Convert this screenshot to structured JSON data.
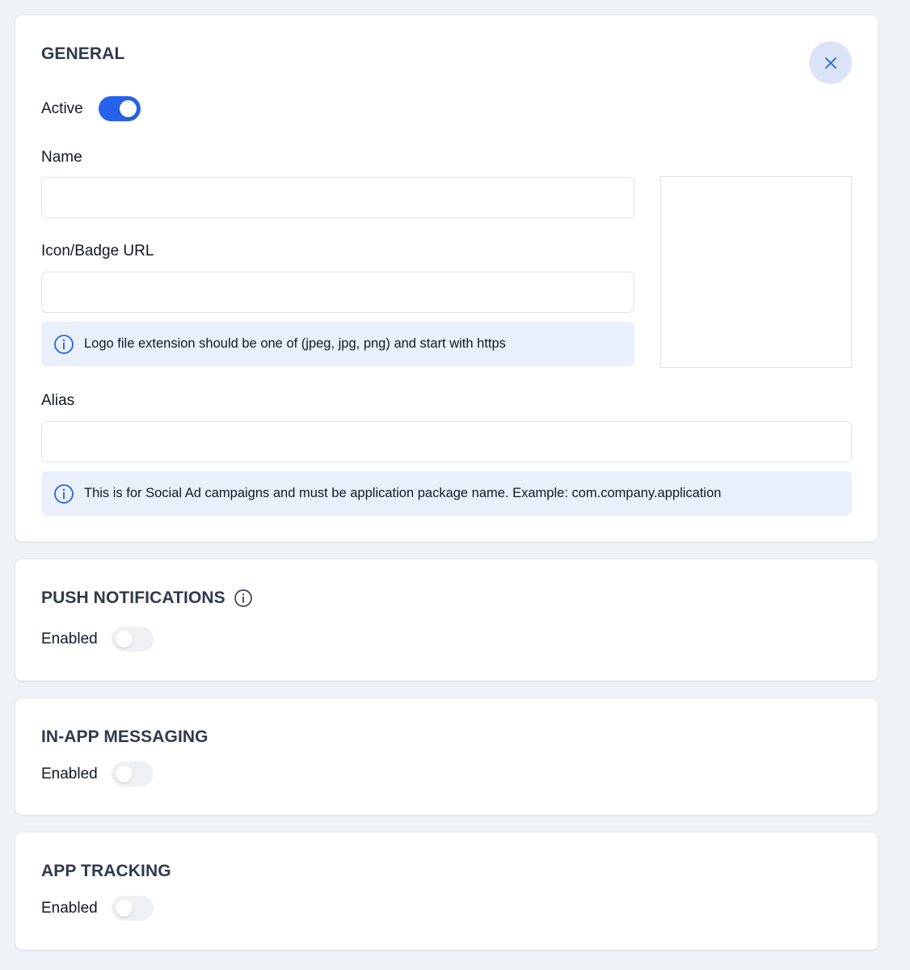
{
  "general": {
    "title": "GENERAL",
    "active_label": "Active",
    "active_on": true,
    "name_label": "Name",
    "name_value": "",
    "icon_url_label": "Icon/Badge URL",
    "icon_url_value": "",
    "icon_note": "Logo file extension should be one of (jpeg, jpg, png) and start with https",
    "alias_label": "Alias",
    "alias_value": "",
    "alias_note": "This is for Social Ad campaigns and must be application package name. Example: com.company.application"
  },
  "push": {
    "title": "PUSH NOTIFICATIONS",
    "enabled_label": "Enabled",
    "enabled_on": false
  },
  "in_app": {
    "title": "IN-APP MESSAGING",
    "enabled_label": "Enabled",
    "enabled_on": false
  },
  "tracking": {
    "title": "APP TRACKING",
    "enabled_label": "Enabled",
    "enabled_on": false
  },
  "icons": {
    "close": "close-icon",
    "info": "info-circle-icon"
  },
  "colors": {
    "accent": "#2563eb",
    "info_bg": "#eaf0fb",
    "close_bg": "#dbe4f7",
    "page_bg": "#eff2f6"
  }
}
